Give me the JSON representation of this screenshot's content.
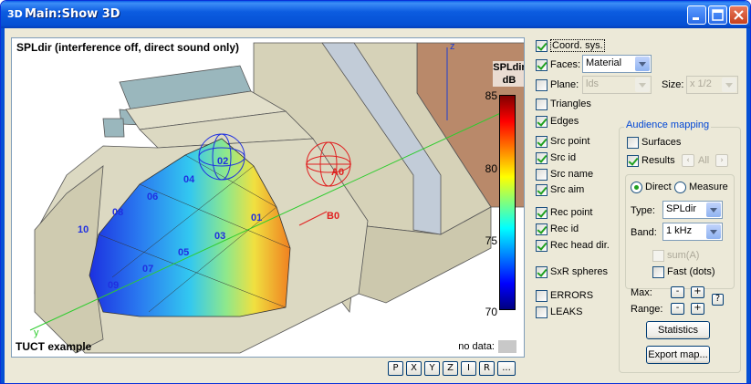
{
  "window": {
    "app_icon": "3D",
    "title": "Main:Show 3D",
    "icons": [
      "minimize-icon",
      "maximize-icon",
      "close-icon"
    ]
  },
  "viewport": {
    "title": "SPLdir (interference off, direct sound only)",
    "footer": "TUCT example",
    "no_data_label": "no data:",
    "axis_labels": {
      "z": "z",
      "y": "y"
    },
    "receivers": [
      "01",
      "02",
      "03",
      "04",
      "05",
      "06",
      "07",
      "08",
      "09",
      "10"
    ],
    "sources": [
      "A0",
      "B0"
    ]
  },
  "legend": {
    "title_line1": "SPLdir",
    "title_line2": "dB",
    "ticks": [
      "85",
      "80",
      "75",
      "70"
    ]
  },
  "view_buttons": [
    "P",
    "X",
    "Y",
    "Z",
    "I",
    "R",
    "..."
  ],
  "controls": {
    "coord_sys": {
      "label": "Coord. sys.",
      "checked": true
    },
    "faces": {
      "label": "Faces:",
      "checked": true,
      "value": "Material"
    },
    "plane": {
      "label": "Plane:",
      "checked": false,
      "value": "lds"
    },
    "size": {
      "label": "Size:",
      "value": "x 1/2"
    },
    "triangles": {
      "label": "Triangles",
      "checked": false
    },
    "edges": {
      "label": "Edges",
      "checked": true
    },
    "src_point": {
      "label": "Src point",
      "checked": true
    },
    "src_id": {
      "label": "Src id",
      "checked": true
    },
    "src_name": {
      "label": "Src name",
      "checked": false
    },
    "src_aim": {
      "label": "Src aim",
      "checked": true
    },
    "rec_point": {
      "label": "Rec point",
      "checked": true
    },
    "rec_id": {
      "label": "Rec id",
      "checked": true
    },
    "rec_head_dir": {
      "label": "Rec head dir.",
      "checked": true
    },
    "sxr_spheres": {
      "label": "SxR spheres",
      "checked": true
    },
    "errors": {
      "label": "ERRORS",
      "checked": false
    },
    "leaks": {
      "label": "LEAKS",
      "checked": false
    }
  },
  "audience_mapping": {
    "caption": "Audience mapping",
    "surfaces": {
      "label": "Surfaces",
      "checked": false
    },
    "results": {
      "label": "Results",
      "checked": true
    },
    "all_label": "All",
    "direct": {
      "label": "Direct",
      "selected": true
    },
    "measure": {
      "label": "Measure",
      "selected": false
    },
    "type": {
      "label": "Type:",
      "value": "SPLdir"
    },
    "band": {
      "label": "Band:",
      "value": "1 kHz"
    },
    "sum_a": {
      "label": "sum(A)",
      "checked": false
    },
    "fast_dots": {
      "label": "Fast (dots)",
      "checked": false
    },
    "max_label": "Max:",
    "range_label": "Range:",
    "minus": "-",
    "plus": "+",
    "help": "?",
    "statistics_button": "Statistics",
    "export_button": "Export map..."
  }
}
